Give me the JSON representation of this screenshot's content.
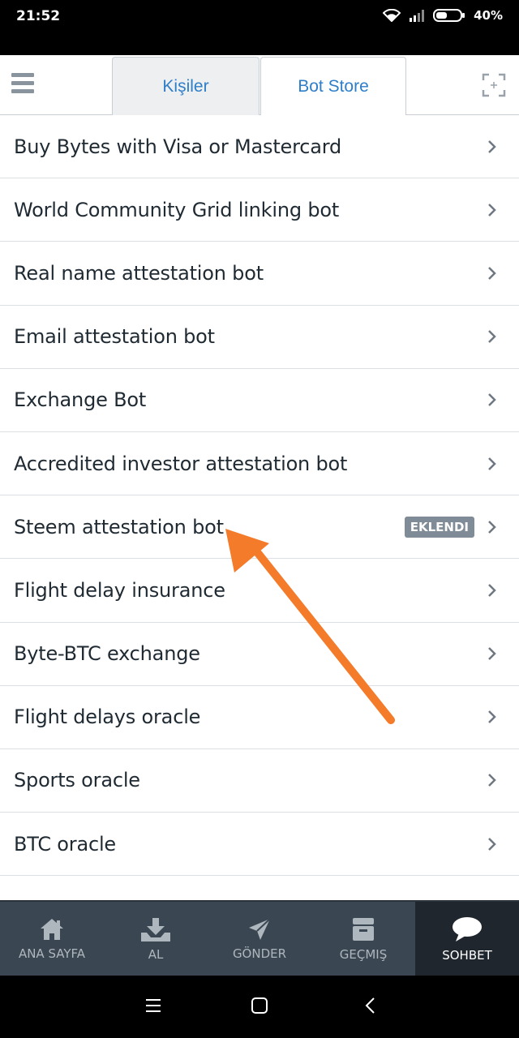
{
  "status_bar": {
    "time": "21:52",
    "battery": "40%"
  },
  "header": {
    "tabs": [
      {
        "label": "Kişiler"
      },
      {
        "label": "Bot Store"
      }
    ]
  },
  "list": {
    "items": [
      {
        "label": "Buy Bytes with Visa or Mastercard"
      },
      {
        "label": "World Community Grid linking bot"
      },
      {
        "label": "Real name attestation bot"
      },
      {
        "label": "Email attestation bot"
      },
      {
        "label": "Exchange Bot"
      },
      {
        "label": "Accredited investor attestation bot"
      },
      {
        "label": "Steem attestation bot",
        "badge": "EKLENDI"
      },
      {
        "label": "Flight delay insurance"
      },
      {
        "label": "Byte-BTC exchange"
      },
      {
        "label": "Flight delays oracle"
      },
      {
        "label": "Sports oracle"
      },
      {
        "label": "BTC oracle"
      }
    ]
  },
  "bottom_nav": {
    "items": [
      {
        "label": "ANA SAYFA",
        "icon": "home-icon"
      },
      {
        "label": "AL",
        "icon": "receive-icon"
      },
      {
        "label": "GÖNDER",
        "icon": "send-icon"
      },
      {
        "label": "GEÇMIŞ",
        "icon": "history-icon"
      },
      {
        "label": "SOHBET",
        "icon": "chat-icon",
        "active": true
      }
    ]
  },
  "colors": {
    "accent": "#2f7ec8",
    "arrow": "#f47b2a",
    "nav_bg": "#3a4651",
    "badge_bg": "#7f8b96"
  }
}
